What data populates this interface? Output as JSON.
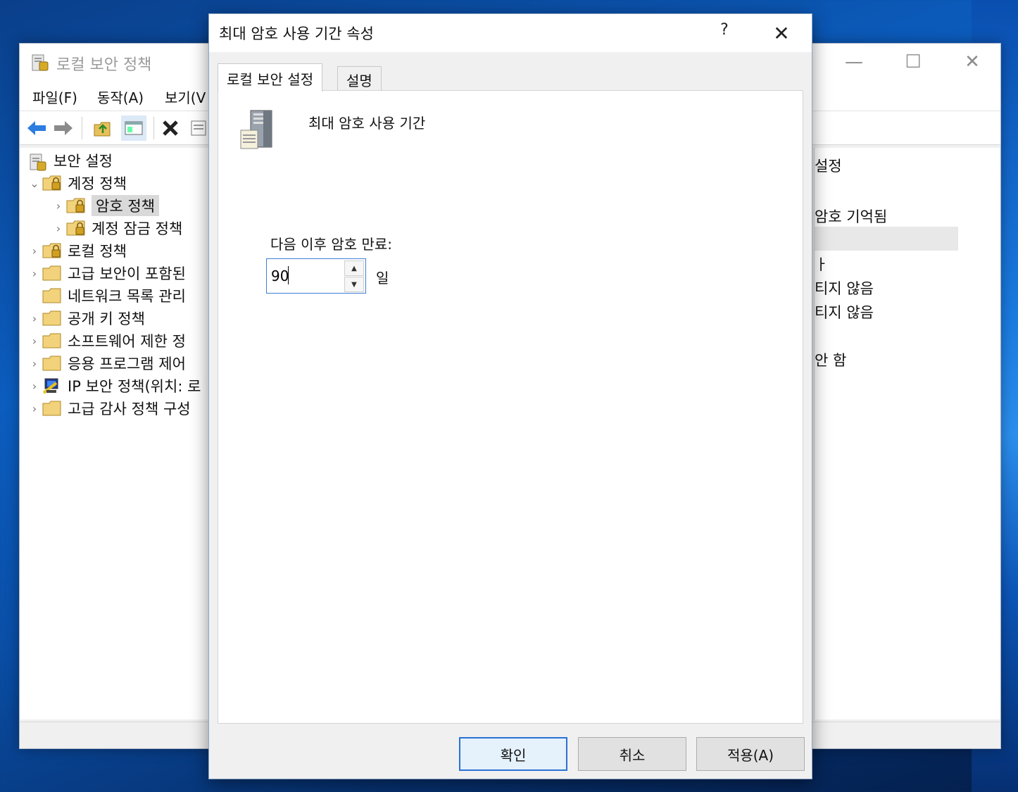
{
  "mmc": {
    "title": "로컬 보안 정책",
    "menu": [
      "파일(F)",
      "동작(A)",
      "보기(V"
    ],
    "tree": [
      {
        "label": "보안 설정",
        "indent": 0,
        "chevron": ""
      },
      {
        "label": "계정 정책",
        "indent": 1,
        "chevron": "⌄"
      },
      {
        "label": "암호 정책",
        "indent": 2,
        "chevron": "›",
        "selected": true
      },
      {
        "label": "계정 잠금 정책",
        "indent": 2,
        "chevron": "›"
      },
      {
        "label": "로컬 정책",
        "indent": 1,
        "chevron": "›"
      },
      {
        "label": "고급 보안이 포함된",
        "indent": 1,
        "chevron": "›"
      },
      {
        "label": "네트워크 목록 관리",
        "indent": 1,
        "chevron": ""
      },
      {
        "label": "공개 키 정책",
        "indent": 1,
        "chevron": "›"
      },
      {
        "label": "소프트웨어 제한 정",
        "indent": 1,
        "chevron": "›"
      },
      {
        "label": "응용 프로그램 제어",
        "indent": 1,
        "chevron": "›"
      },
      {
        "label": "IP 보안 정책(위치: 로",
        "indent": 1,
        "chevron": "›"
      },
      {
        "label": "고급 감사 정책 구성",
        "indent": 1,
        "chevron": "›"
      }
    ],
    "right_column_header": "설정",
    "right_values": [
      "암호 기억됨",
      "",
      "ㅏ",
      "티지 않음",
      "티지 않음",
      "",
      "안 함"
    ]
  },
  "dialog": {
    "title": "최대 암호 사용 기간 속성",
    "help_glyph": "?",
    "close_glyph": "✕",
    "tabs": [
      "로컬 보안 설정",
      "설명"
    ],
    "policy_name": "최대 암호 사용 기간",
    "expire_label": "다음 이후 암호 만료:",
    "days_value": "90",
    "days_unit": "일",
    "buttons": {
      "ok": "확인",
      "cancel": "취소",
      "apply": "적용(A)"
    }
  }
}
